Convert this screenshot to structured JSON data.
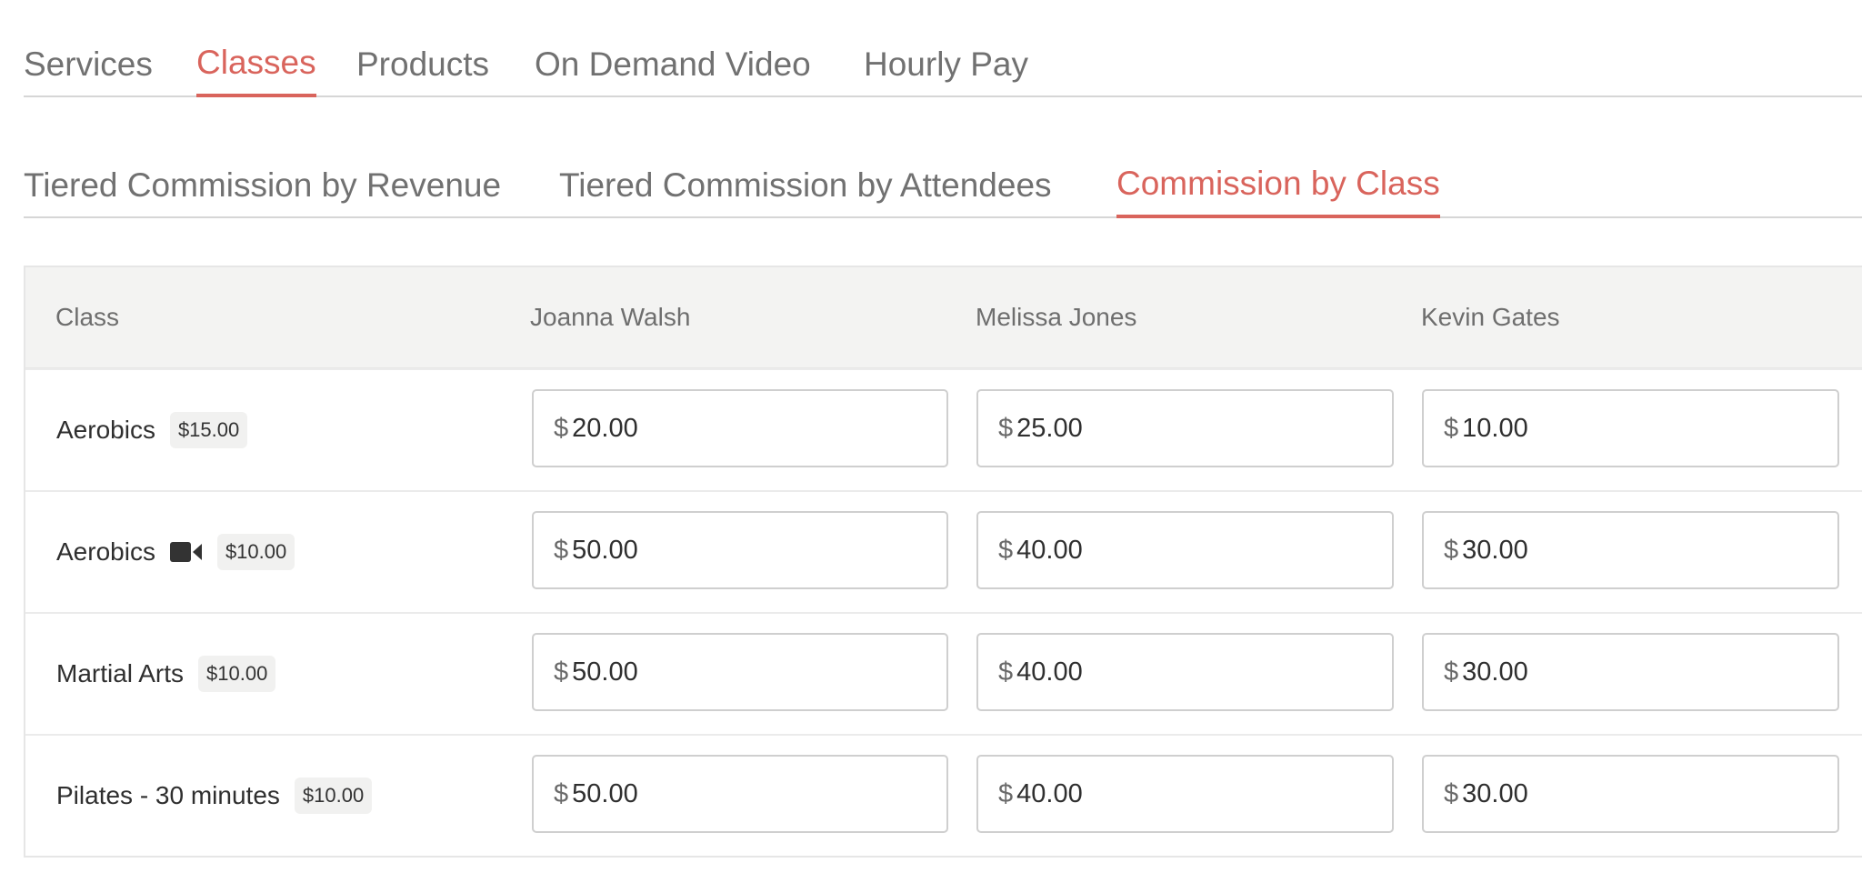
{
  "primary_tabs": [
    {
      "label": "Services",
      "active": false
    },
    {
      "label": "Classes",
      "active": true
    },
    {
      "label": "Products",
      "active": false
    },
    {
      "label": "On Demand Video",
      "active": false
    },
    {
      "label": "Hourly Pay",
      "active": false
    }
  ],
  "secondary_tabs": [
    {
      "label": "Tiered Commission by Revenue",
      "active": false
    },
    {
      "label": "Tiered Commission by Attendees",
      "active": false
    },
    {
      "label": "Commission by Class",
      "active": true
    }
  ],
  "table": {
    "headers": [
      "Class",
      "Joanna Walsh",
      "Melissa Jones",
      "Kevin Gates"
    ],
    "currency_symbol": "$",
    "rows": [
      {
        "name": "Aerobics",
        "video": false,
        "price": "$15.00",
        "values": [
          "20.00",
          "25.00",
          "10.00"
        ]
      },
      {
        "name": "Aerobics",
        "video": true,
        "video_icon": "video-camera-icon",
        "price": "$10.00",
        "values": [
          "50.00",
          "40.00",
          "30.00"
        ]
      },
      {
        "name": "Martial Arts",
        "video": false,
        "price": "$10.00",
        "values": [
          "50.00",
          "40.00",
          "30.00"
        ]
      },
      {
        "name": "Pilates - 30 minutes",
        "video": false,
        "price": "$10.00",
        "values": [
          "50.00",
          "40.00",
          "30.00"
        ]
      }
    ]
  },
  "colors": {
    "accent": "#d9645c",
    "tab_text": "#717171",
    "header_bg": "#f3f3f2"
  }
}
